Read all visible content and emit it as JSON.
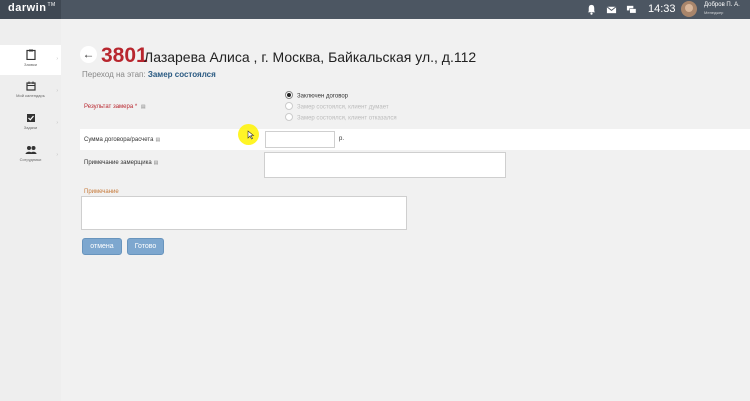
{
  "app": {
    "logo": "darwin",
    "logo_mark": "TM"
  },
  "topbar": {
    "clock": "14:33",
    "user_name": "Добров П. А.",
    "user_role": "Менеджер",
    "icons": [
      "bell-icon",
      "mail-icon",
      "chat-icon"
    ]
  },
  "sidebar": {
    "items": [
      {
        "label": "Заявки",
        "icon": "clipboard-icon",
        "active": true
      },
      {
        "label": "Мой календарь",
        "icon": "calendar-icon",
        "active": false
      },
      {
        "label": "Задачи",
        "icon": "check-icon",
        "active": false
      },
      {
        "label": "Сотрудники",
        "icon": "people-icon",
        "active": false
      }
    ]
  },
  "header": {
    "back": "←",
    "order_number": "3801",
    "title": "Лазарева Алиса , г. Москва, Байкальская ул., д.112",
    "stage_prefix": "Переход на этап:",
    "stage_name": "Замер состоялся"
  },
  "form": {
    "result_label": "Результат замера",
    "result_required": "*",
    "info_icon": "▤",
    "result_options": [
      {
        "label": "Заключен договор",
        "checked": true,
        "disabled": false
      },
      {
        "label": "Замер состоялся, клиент думает",
        "checked": false,
        "disabled": true
      },
      {
        "label": "Замер состоялся, клиент отказался",
        "checked": false,
        "disabled": true
      }
    ],
    "sum_label": "Сумма договора/расчета",
    "sum_value": "",
    "currency": "р.",
    "notes_label": "Примечание замерщика",
    "notes_value": "",
    "comment_label": "Примечание",
    "comment_value": ""
  },
  "buttons": {
    "cancel": "отмена",
    "done": "Готово"
  },
  "colors": {
    "accent": "#b8262e",
    "primary_button": "#7da7cf",
    "topbar": "#4c5662",
    "stage": "#2a5a82"
  }
}
